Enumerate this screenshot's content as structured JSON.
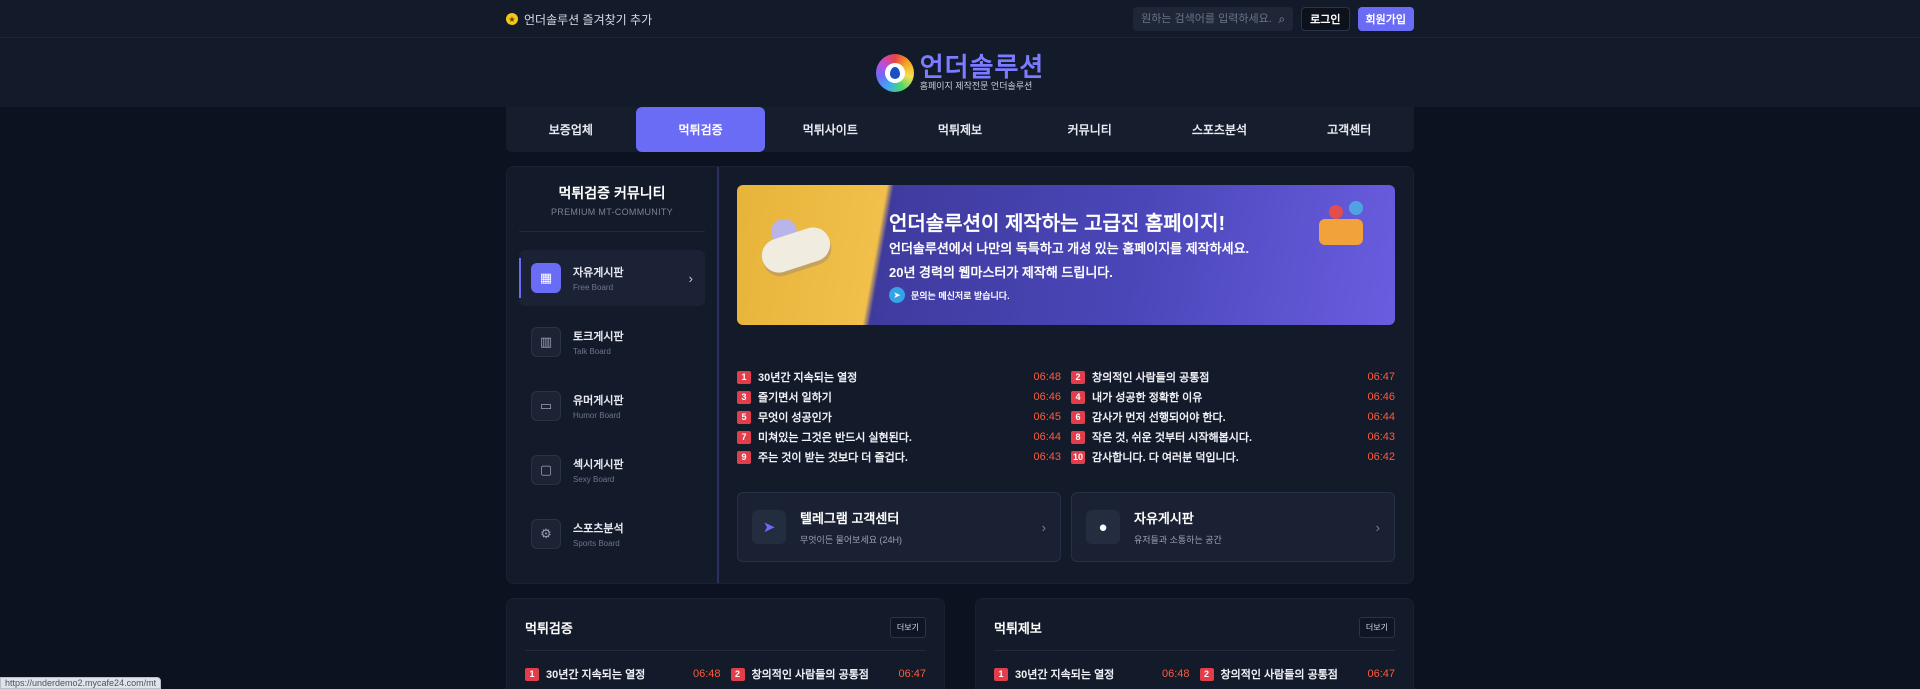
{
  "topbar": {
    "favorite_label": "언더솔루션 즐겨찾기 추가",
    "search_placeholder": "원하는 검색어를 입력하세요.",
    "login_label": "로그인",
    "join_label": "회원가입"
  },
  "logo": {
    "title": "언더솔루션",
    "subtitle": "홈페이지 제작전문 언더솔루션"
  },
  "nav": {
    "items": [
      {
        "label": "보증업체"
      },
      {
        "label": "먹튀검증"
      },
      {
        "label": "먹튀사이트"
      },
      {
        "label": "먹튀제보"
      },
      {
        "label": "커뮤니티"
      },
      {
        "label": "스포츠분석"
      },
      {
        "label": "고객센터"
      }
    ],
    "active": "먹튀검증"
  },
  "sidebar": {
    "title": "먹튀검증 커뮤니티",
    "subtitle": "PREMIUM MT-COMMUNITY",
    "items": [
      {
        "label": "자유게시판",
        "sub": "Free Board",
        "icon": "grid-icon"
      },
      {
        "label": "토크게시판",
        "sub": "Talk Board",
        "icon": "bar-chart-icon"
      },
      {
        "label": "유머게시판",
        "sub": "Humor Board",
        "icon": "folder-icon"
      },
      {
        "label": "섹시게시판",
        "sub": "Sexy Board",
        "icon": "chat-bubble-icon"
      },
      {
        "label": "스포츠분석",
        "sub": "Sports Board",
        "icon": "gear-icon"
      }
    ]
  },
  "banner": {
    "headline": "언더솔루션이 제작하는 고급진 홈페이지!",
    "line1": "언더솔루션에서 나만의 독특하고 개성 있는 홈페이지를 제작하세요.",
    "line2": "20년 경력의 웹마스터가 제작해 드립니다.",
    "contact": "문의는 메신저로 받습니다."
  },
  "posts": [
    {
      "n": "1",
      "title": "30년간 지속되는 열정",
      "time": "06:48"
    },
    {
      "n": "2",
      "title": "창의적인 사람들의 공통점",
      "time": "06:47"
    },
    {
      "n": "3",
      "title": "즐기면서 일하기",
      "time": "06:46"
    },
    {
      "n": "4",
      "title": "내가 성공한 정확한 이유",
      "time": "06:46"
    },
    {
      "n": "5",
      "title": "무엇이 성공인가",
      "time": "06:45"
    },
    {
      "n": "6",
      "title": "감사가 먼저 선행되어야 한다.",
      "time": "06:44"
    },
    {
      "n": "7",
      "title": "미쳐있는 그것은 반드시 실현된다.",
      "time": "06:44"
    },
    {
      "n": "8",
      "title": "작은 것, 쉬운 것부터 시작해봅시다.",
      "time": "06:43"
    },
    {
      "n": "9",
      "title": "주는 것이 받는 것보다 더 즐겁다.",
      "time": "06:43"
    },
    {
      "n": "10",
      "title": "감사합니다. 다 여러분 덕입니다.",
      "time": "06:42"
    }
  ],
  "cards": [
    {
      "title": "텔레그램 고객센터",
      "sub": "무엇이든 물어보세요 (24H)",
      "icon": "telegram-icon"
    },
    {
      "title": "자유게시판",
      "sub": "유저들과 소통하는 공간",
      "icon": "chat-icon"
    }
  ],
  "bottom_panels": [
    {
      "title": "먹튀검증",
      "more": "더보기",
      "posts": [
        {
          "n": "1",
          "title": "30년간 지속되는 열정",
          "time": "06:48"
        },
        {
          "n": "2",
          "title": "창의적인 사람들의 공통점",
          "time": "06:47"
        }
      ]
    },
    {
      "title": "먹튀제보",
      "more": "더보기",
      "posts": [
        {
          "n": "1",
          "title": "30년간 지속되는 열정",
          "time": "06:48"
        },
        {
          "n": "2",
          "title": "창의적인 사람들의 공통점",
          "time": "06:47"
        }
      ]
    }
  ],
  "status_url": "https://underdemo2.mycafe24.com/mt",
  "colors": {
    "accent": "#6b6cf6",
    "background": "#0d1220",
    "panel": "#131a2a",
    "badge": "#e23d4a",
    "time": "#ff5a3c"
  }
}
